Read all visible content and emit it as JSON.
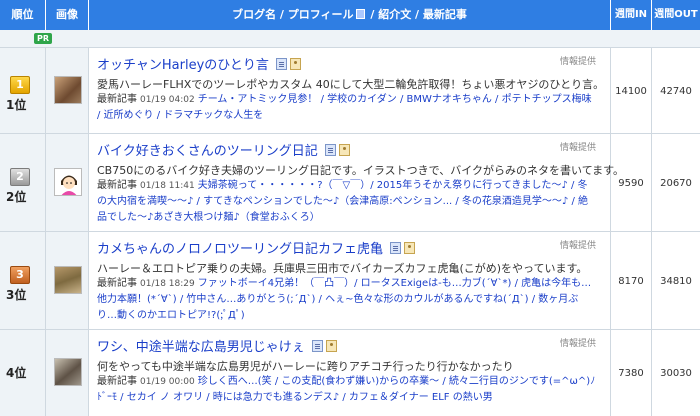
{
  "header": {
    "rank": "順位",
    "image": "画像",
    "blog_pre": "ブログ名 / プロフィール",
    "blog_post": " / 紹介文 / 最新記事",
    "weekly_in": "週間IN",
    "weekly_out": "週間OUT"
  },
  "pr_label": "PR",
  "info_label": "情報提供",
  "recent_label": "最新記事",
  "entries": [
    {
      "rank": "1位",
      "medal": "1",
      "title": "オッチャンHarleyのひとり言",
      "desc": "愛馬ハーレーFLHXでのツーレポやカスタム 40にして大型二輪免許取得！ちょい悪オヤジのひとり言。",
      "date": "01/19 04:02",
      "links": "チーム・アトミック見参！ / 学校のカイダン / BMWナオキちゃん / ポテトチップス梅味 / 近所めぐり / ドラマチックな人生を",
      "weekly_in": "14100",
      "weekly_out": "42740"
    },
    {
      "rank": "2位",
      "medal": "2",
      "title": "バイク好きおくさんのツーリング日記",
      "desc": "CB750にのるバイク好き夫婦のツーリング日記です。イラストつきで、バイクがらみのネタを書いてます。",
      "date": "01/18 11:41",
      "links": "夫婦茶碗って・・・・・・?（￣▽￣）/ 2015年うそかえ祭りに行ってきました～♪ / 冬の大内宿を満喫～～♪ / すてきなペンションでした～♪（会津高原:ペンション... / 冬の花泉酒造見学～～♪ / 絶品でした～♪あざき大根つけ麺♪（食堂おふくろ）",
      "weekly_in": "9590",
      "weekly_out": "20670"
    },
    {
      "rank": "3位",
      "medal": "3",
      "title": "カメちゃんのノロノロツーリング日記カフェ虎亀",
      "desc": "ハーレー＆エロトピア乗りの夫婦。兵庫県三田市でバイカーズカフェ虎亀(こがめ)をやっています。",
      "date": "01/18 18:29",
      "links": "ファットボーイ4兄弟！（￣凸￣）/ ロータスExigeは-も…力ブ(´∀`*) / 虎亀は今年も…他力本願！(*´∀`) / 竹中さん…ありがとう(;´Д`) / ヘぇ~色々な形のカウルがあるんですね(´Д`) / 数ヶ月ぶり…動くのかエロトピア!?(;ﾟДﾟ)",
      "weekly_in": "8170",
      "weekly_out": "34810"
    },
    {
      "rank": "4位",
      "medal": "",
      "title": "ワシ、中途半端な広島男児じゃけぇ",
      "desc": "何をやっても中途半端な広島男児がハーレーに跨りアチコチ行ったり行かなかったり",
      "date": "01/19 00:00",
      "links": "珍しく西へ…(笑 / この支配(食わず嫌い)からの卒業～ / 続々二行目のジンです(=^ω^)ﾉﾄﾞｰﾓ / セカイ ノ オワリ / 時には急力でも進るンデス♪ / カフェ＆ダイナー ELF の熱い男",
      "weekly_in": "7380",
      "weekly_out": "30030"
    }
  ]
}
